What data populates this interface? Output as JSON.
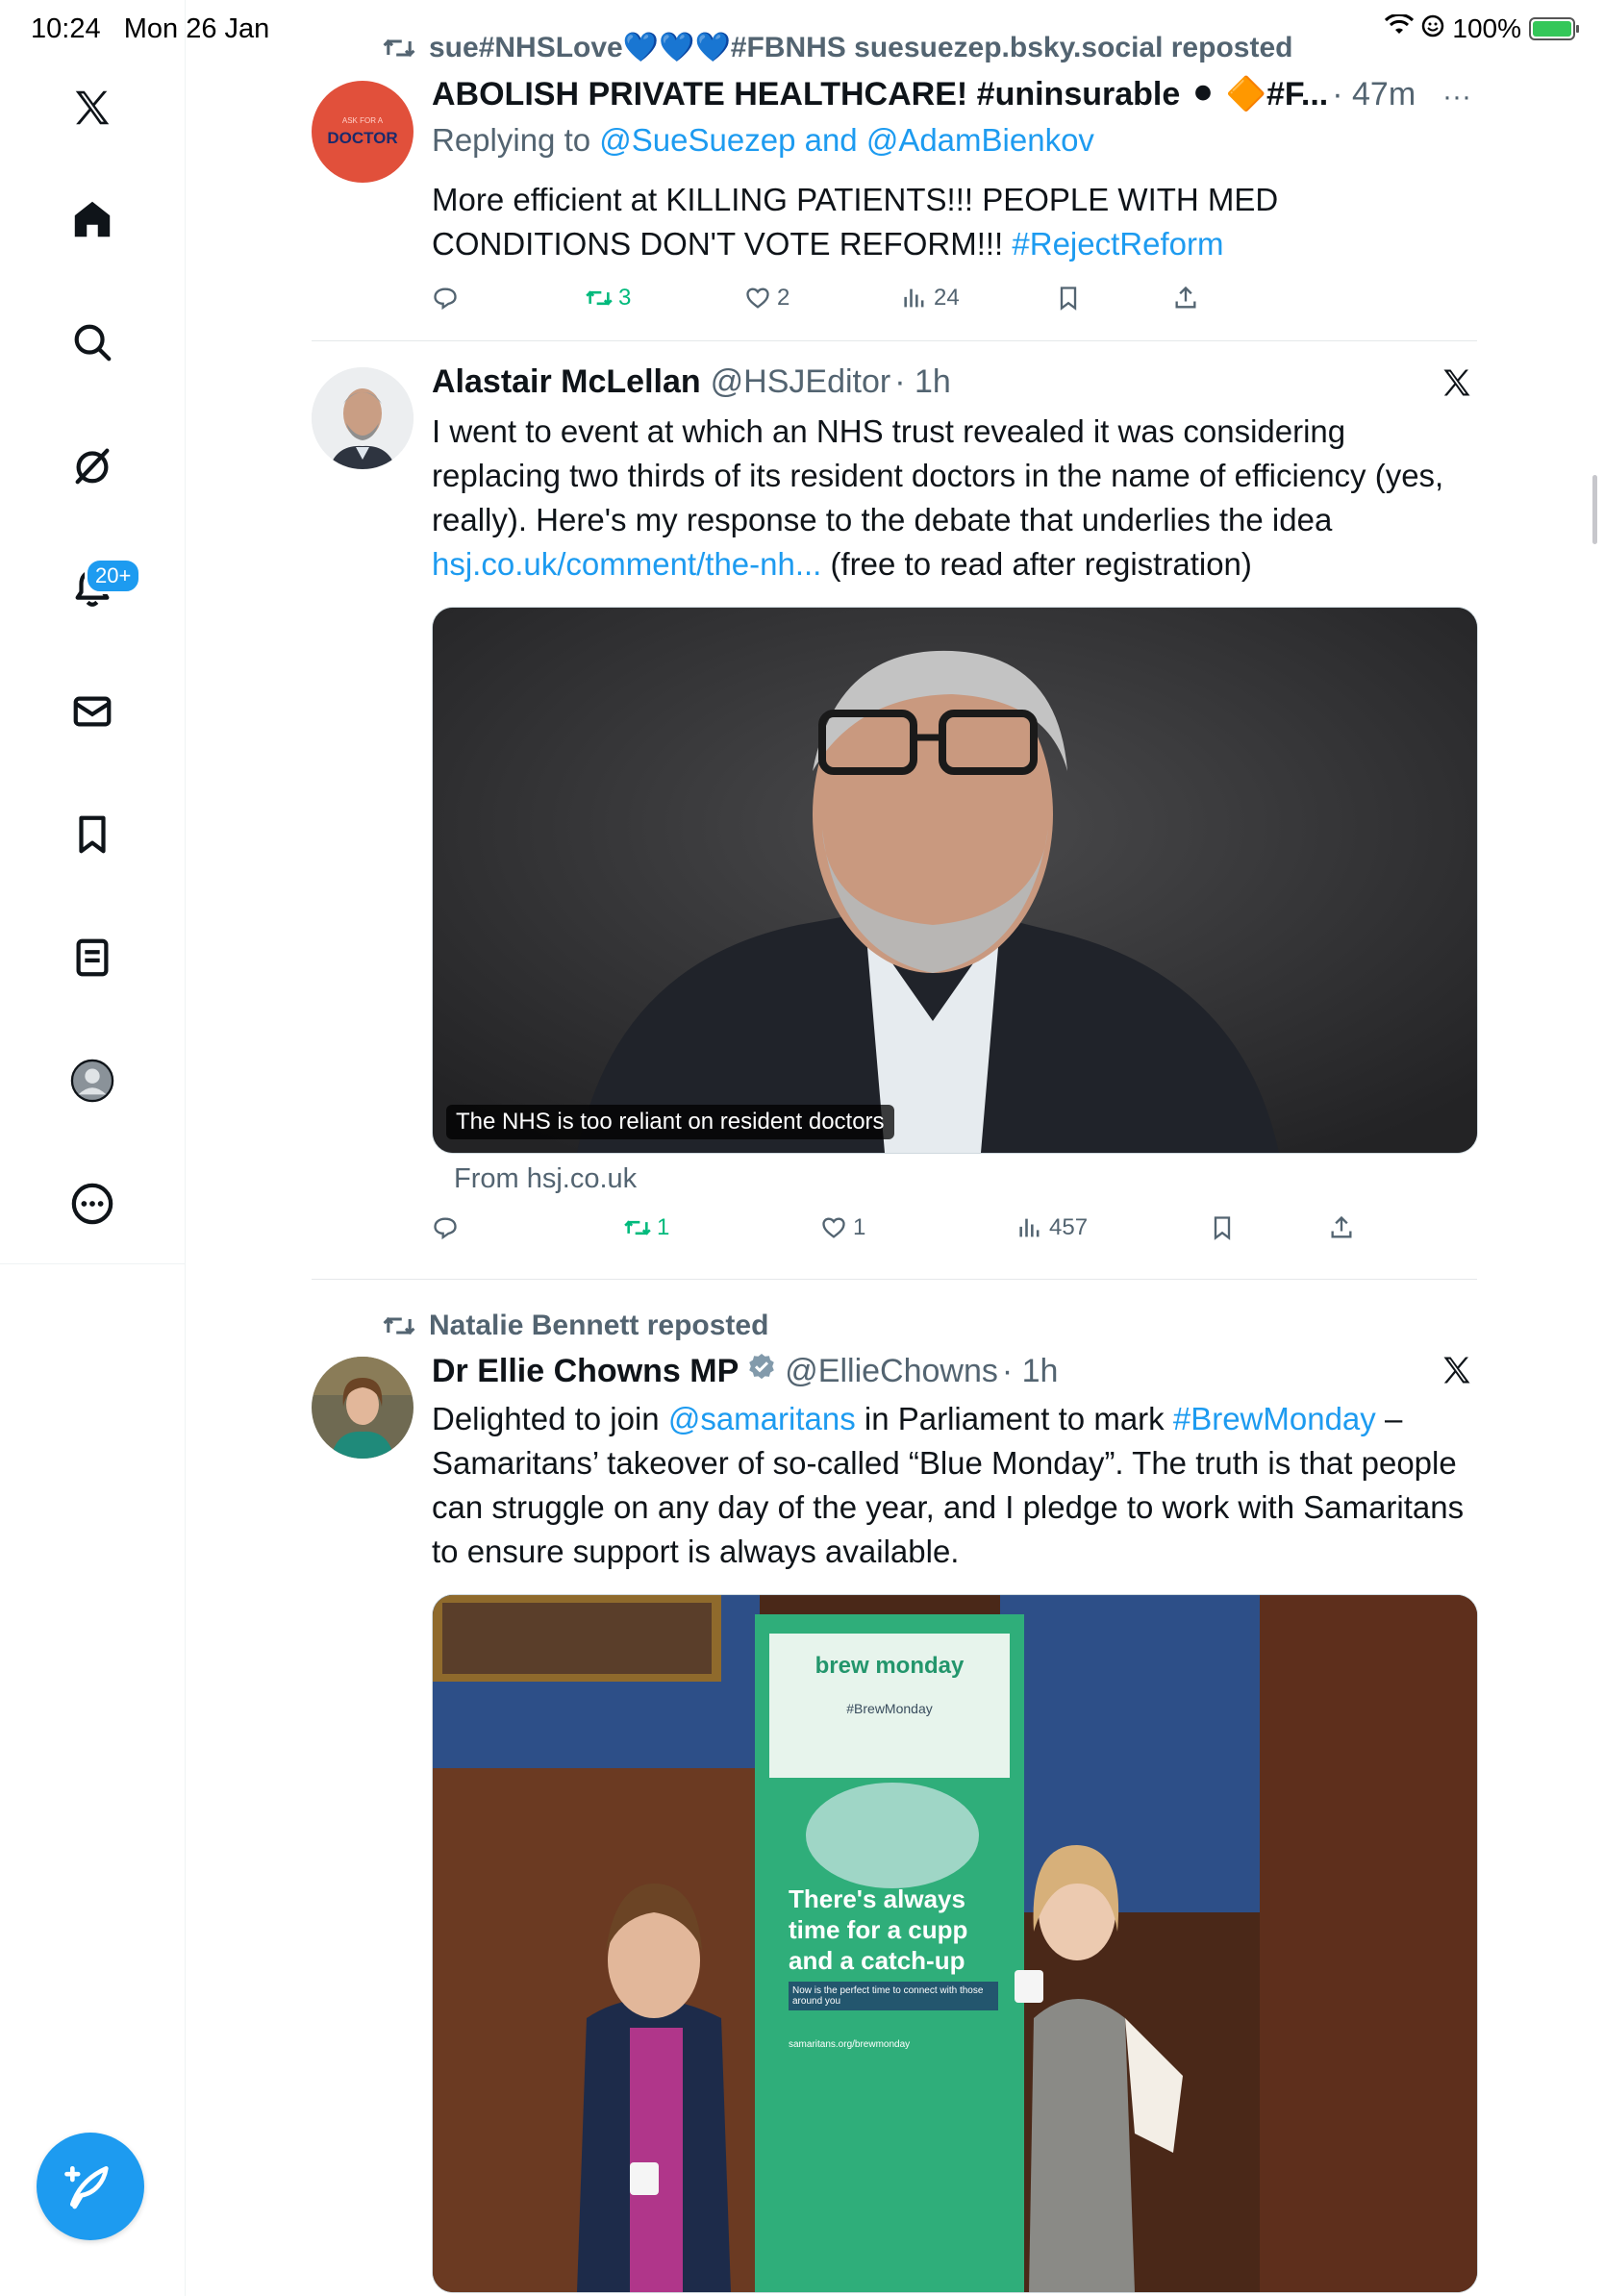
{
  "status_bar": {
    "time": "10:24",
    "date": "Mon 26 Jan",
    "battery": "100%"
  },
  "sidebar": {
    "items": [
      {
        "icon": "x-logo-icon"
      },
      {
        "icon": "home-icon"
      },
      {
        "icon": "search-icon"
      },
      {
        "icon": "grok-icon"
      },
      {
        "icon": "notifications-icon",
        "badge": "20+"
      },
      {
        "icon": "messages-icon"
      },
      {
        "icon": "bookmarks-icon"
      },
      {
        "icon": "lists-icon"
      },
      {
        "icon": "profile-icon"
      },
      {
        "icon": "more-icon"
      }
    ],
    "compose_icon": "compose-icon"
  },
  "colors": {
    "accent": "#1d9bf0",
    "repost_green": "#00ba7c",
    "muted": "#536471"
  },
  "posts": [
    {
      "repost_label": "sue#NHSLove💙💙💙#FBNHS suesuezep.bsky.social reposted",
      "avatar_text_top": "ASK FOR A",
      "avatar_text_main": "DOCTOR",
      "name": "ABOLISH PRIVATE HEALTHCARE! #uninsurable ⚫ 🔶#F...",
      "time": "· 47m",
      "reply_prefix": "Replying to",
      "reply_to": "@SueSuezep and @AdamBienkov",
      "text": "More efficient at KILLING PATIENTS!!! PEOPLE WITH MED CONDITIONS DON'T VOTE REFORM!!!",
      "hashtag": "#RejectReform",
      "reposts": "3",
      "likes": "2",
      "views": "24"
    },
    {
      "name": "Alastair McLellan",
      "handle": "@HSJEditor",
      "time": "· 1h",
      "text": "I went to event at which an NHS trust revealed it was considering replacing two thirds of its resident doctors in the name of efficiency (yes, really). Here's my response to the debate that underlies the idea",
      "link": "hsj.co.uk/comment/the-nh...",
      "text_after_link": " (free to read after registration)",
      "card_caption": "The NHS is too reliant on resident doctors",
      "card_source": "From hsj.co.uk",
      "reposts": "1",
      "likes": "1",
      "views": "457"
    },
    {
      "repost_label": "Natalie Bennett reposted",
      "name": "Dr Ellie Chowns MP",
      "handle": "@EllieChowns",
      "time": "· 1h",
      "text_1": "Delighted to join ",
      "mention": "@samaritans",
      "text_2": " in Parliament to mark ",
      "hashtag": "#BrewMonday",
      "text_3": " – Samaritans’ takeover of so-called “Blue Monday”. The truth is that people can struggle on any day of the year, and I pledge to work with Samaritans to ensure support is always available.",
      "banner_brand": "brew monday",
      "banner_tag": "#BrewMonday",
      "banner_line_1": "There's always",
      "banner_line_2": "time for a cupp",
      "banner_line_3": "and a catch-up",
      "banner_small": "Now is the perfect time to connect with those around you",
      "banner_url": "samaritans.org/brewmonday"
    }
  ]
}
